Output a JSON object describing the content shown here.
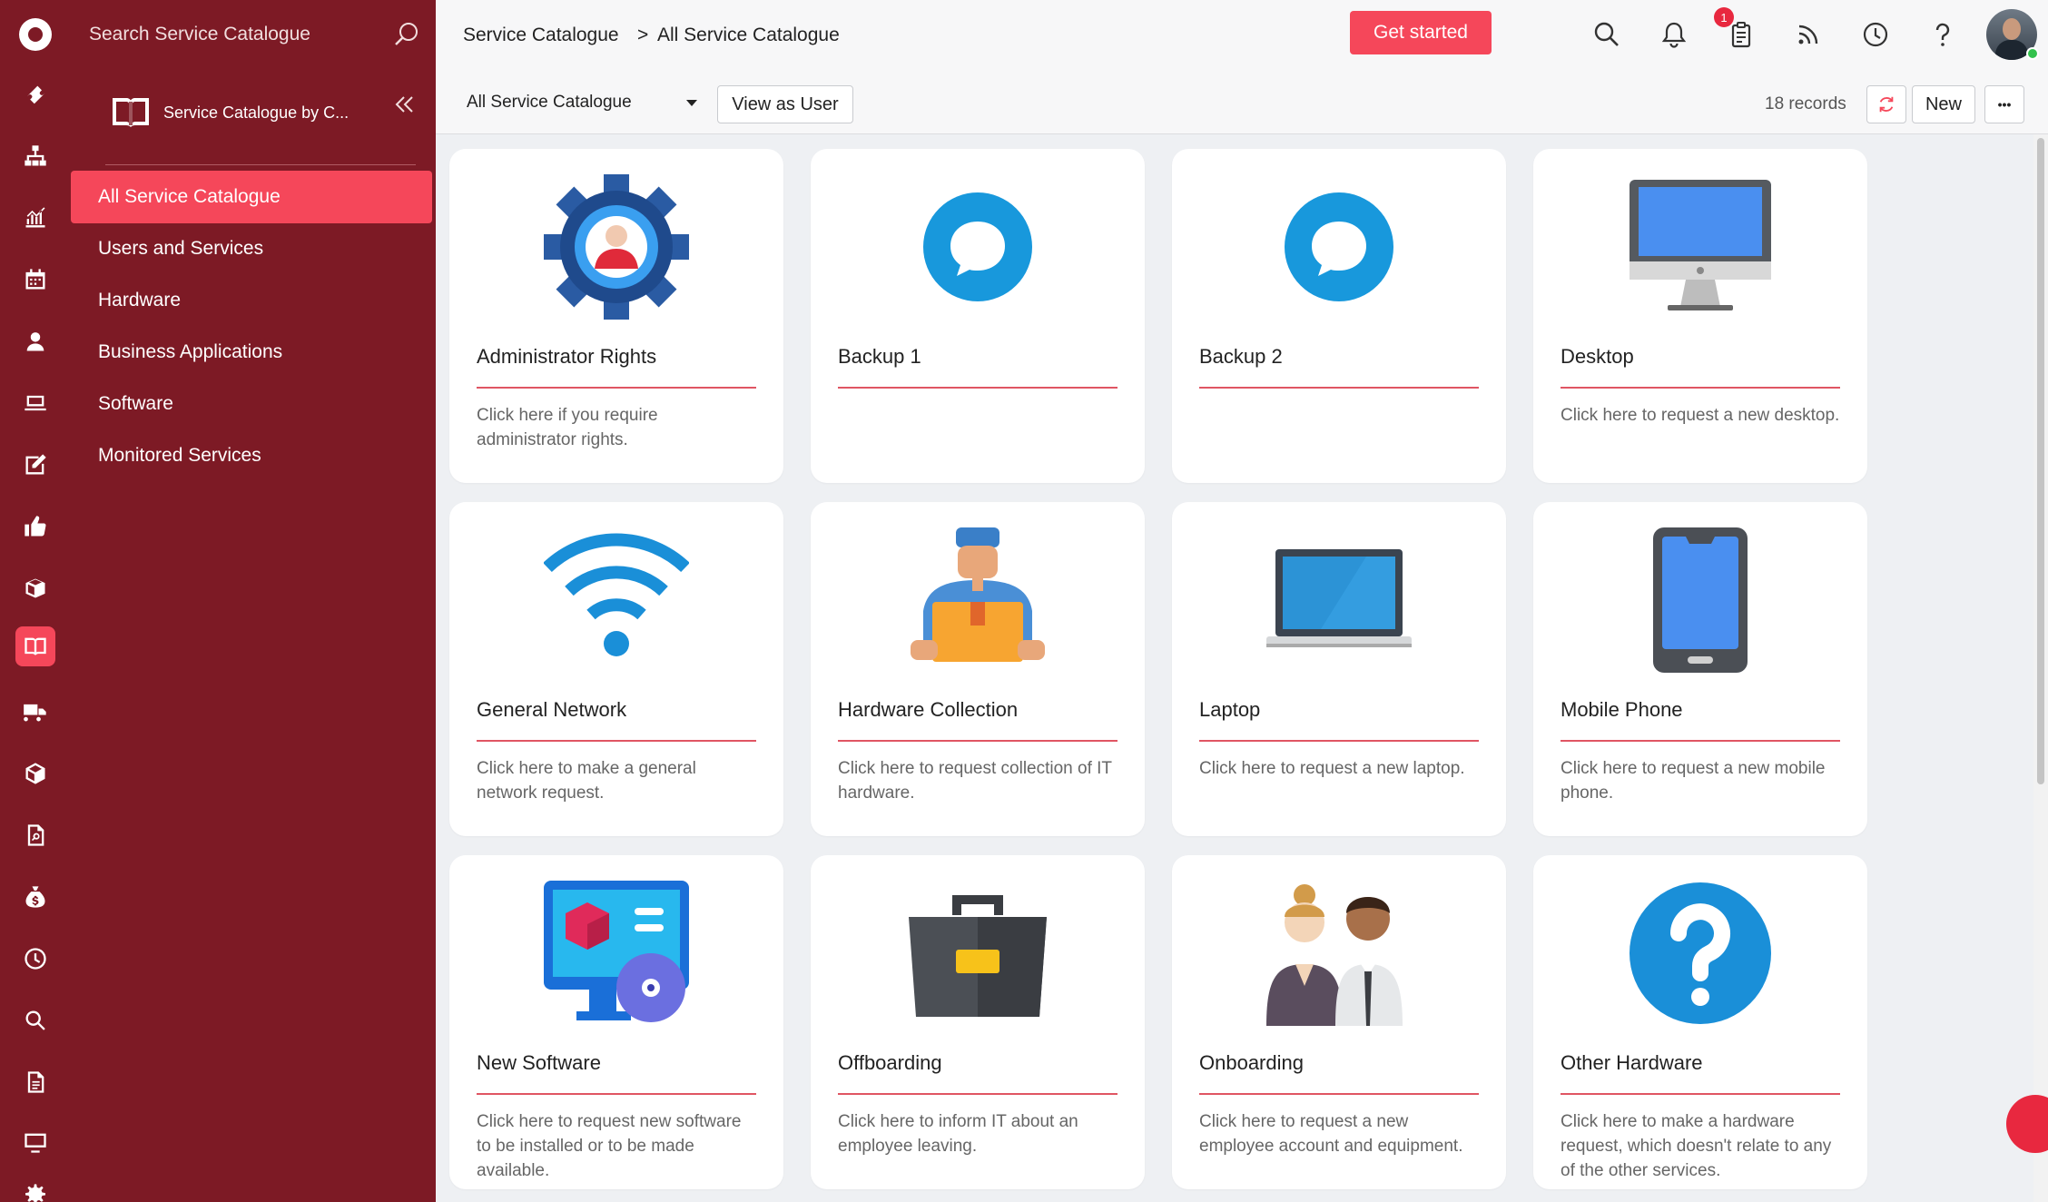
{
  "sidebar": {
    "search_placeholder": "Search Service Catalogue",
    "catalog_name": "Service Catalogue by C...",
    "items": [
      {
        "label": "All Service Catalogue",
        "active": true
      },
      {
        "label": "Users and Services"
      },
      {
        "label": "Hardware"
      },
      {
        "label": "Business Applications"
      },
      {
        "label": "Software"
      },
      {
        "label": "Monitored Services"
      }
    ]
  },
  "rail": {
    "icons": [
      "ticket-icon",
      "org-chart-icon",
      "reports-icon",
      "calendar-icon",
      "user-icon",
      "laptop-icon",
      "edit-icon",
      "thumbs-up-icon",
      "boxes-icon",
      "book-icon",
      "truck-icon",
      "package-icon",
      "document-search-icon",
      "money-bag-icon",
      "clock-icon",
      "search-icon",
      "file-icon",
      "monitor-icon",
      "settings-icon"
    ],
    "active_icon": "book-icon"
  },
  "header": {
    "breadcrumb_root": "Service Catalogue",
    "breadcrumb_sep": ">",
    "breadcrumb_current": "All Service Catalogue",
    "get_started": "Get started",
    "notification_count": "1"
  },
  "toolbar": {
    "filter_value": "All Service Catalogue",
    "view_as_user": "View as User",
    "records": "18 records",
    "new_label": "New",
    "more_label": "•••"
  },
  "cards": [
    {
      "title": "Administrator Rights",
      "desc": "Click here if you require administrator rights.",
      "icon": "gear-user-icon"
    },
    {
      "title": "Backup 1",
      "desc": "",
      "icon": "chat-bubble-icon"
    },
    {
      "title": "Backup 2",
      "desc": "",
      "icon": "chat-bubble-icon"
    },
    {
      "title": "Desktop",
      "desc": "Click here to request a new desktop.",
      "icon": "desktop-icon"
    },
    {
      "title": "General Network",
      "desc": "Click here to make a general network request.",
      "icon": "wifi-icon"
    },
    {
      "title": "Hardware Collection",
      "desc": "Click here to request collection of IT hardware.",
      "icon": "courier-icon"
    },
    {
      "title": "Laptop",
      "desc": "Click here to request a new laptop.",
      "icon": "laptop-icon"
    },
    {
      "title": "Mobile Phone",
      "desc": "Click here to request a new mobile phone.",
      "icon": "mobile-phone-icon"
    },
    {
      "title": "New Software",
      "desc": "Click here to request new software to be installed or to be made available.",
      "icon": "software-icon"
    },
    {
      "title": "Offboarding",
      "desc": "Click here to inform IT about an employee leaving.",
      "icon": "briefcase-icon"
    },
    {
      "title": "Onboarding",
      "desc": "Click here to request a new employee account and equipment.",
      "icon": "people-icon"
    },
    {
      "title": "Other Hardware",
      "desc": "Click here to make a hardware request, which doesn't relate to any of the other services.",
      "icon": "question-icon"
    }
  ],
  "colors": {
    "brand": "#7d1a25",
    "accent": "#f5475a",
    "underline": "#e05563"
  }
}
